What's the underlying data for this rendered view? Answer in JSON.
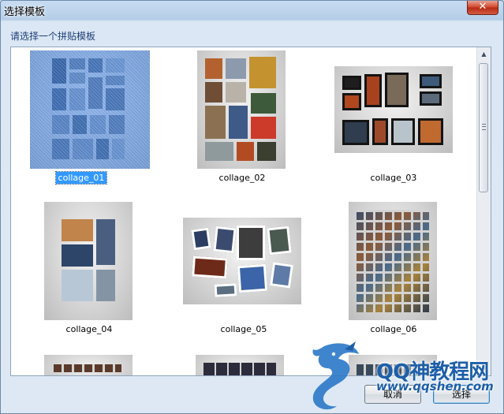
{
  "window": {
    "title": "选择模板",
    "close_glyph": "✕"
  },
  "prompt": "请选择一个拼贴模板",
  "templates": [
    {
      "label": "collage_01",
      "selected": true
    },
    {
      "label": "collage_02",
      "selected": false
    },
    {
      "label": "collage_03",
      "selected": false
    },
    {
      "label": "collage_04",
      "selected": false
    },
    {
      "label": "collage_05",
      "selected": false
    },
    {
      "label": "collage_06",
      "selected": false
    }
  ],
  "scrollbar": {
    "up_arrow": "▲",
    "down_arrow": "▼"
  },
  "buttons": {
    "cancel": "取消",
    "select": "选择"
  },
  "watermark": {
    "text": "QQ神教程网",
    "url": "www.qqshen.com"
  },
  "colors": {
    "selection": "#3399ff",
    "prompt_text": "#1e3f78",
    "watermark": "#1e5fa8"
  }
}
